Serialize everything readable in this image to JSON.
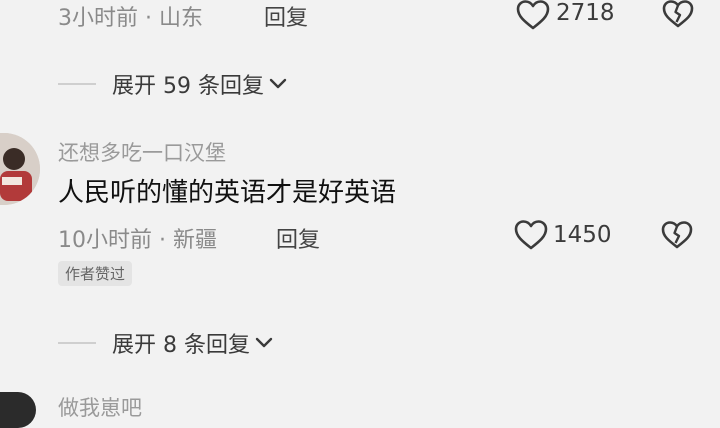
{
  "comment1": {
    "meta": "3小时前 · 山东",
    "reply_label": "回复",
    "like_count": "2718",
    "like_icon": "heart-outline-icon",
    "dislike_icon": "broken-heart-icon"
  },
  "expand1": {
    "label": "展开 59 条回复"
  },
  "comment2": {
    "username": "还想多吃一口汉堡",
    "text": "人民听的懂的英语才是好英语",
    "meta": "10小时前 · 新疆",
    "reply_label": "回复",
    "like_count": "1450",
    "badge": "作者赞过",
    "like_icon": "heart-outline-icon",
    "dislike_icon": "broken-heart-icon"
  },
  "expand2": {
    "label": "展开 8 条回复"
  },
  "comment3": {
    "username_partial": "做我崽吧"
  },
  "colors": {
    "background": "#f2f2f2",
    "text": "#111111",
    "muted": "#8a8a8a"
  }
}
